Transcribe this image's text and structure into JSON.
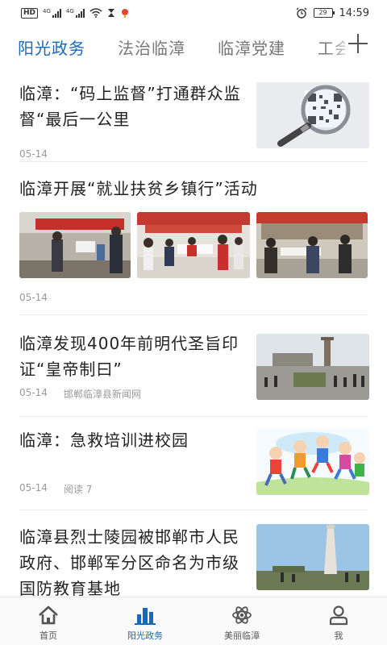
{
  "status_bar": {
    "hd": "HD",
    "net_1": "4G",
    "net_2": "4G",
    "battery": "29",
    "time": "14:59"
  },
  "tabs": [
    {
      "label": "阳光政务",
      "active": true
    },
    {
      "label": "法治临漳",
      "active": false
    },
    {
      "label": "临漳党建",
      "active": false
    },
    {
      "label": "工会",
      "active": false
    }
  ],
  "feed": [
    {
      "title": "临漳：“码上监督”打通群众监督“最后一公里",
      "date": "05-14",
      "source": "",
      "reads": "",
      "image": "magnifier-qr-photo"
    },
    {
      "title": "临漳开展“就业扶贫乡镇行”活动",
      "date": "05-14",
      "source": "",
      "reads": "",
      "images": [
        "event-photo-1",
        "event-photo-2",
        "event-photo-3"
      ]
    },
    {
      "title": "临漳发现400年前明代圣旨印证“皇帝制曰”",
      "date": "05-14",
      "source": "邯郸临漳县新闻网",
      "reads": "",
      "image": "plaza-photo"
    },
    {
      "title": "临漳：急救培训进校园",
      "date": "05-14",
      "source": "",
      "reads": "阅读 7",
      "image": "cartoon-kids-image"
    },
    {
      "title": "临漳县烈士陵园被邯郸市人民政府、邯郸军分区命名为市级国防教育基地",
      "date": "",
      "source": "",
      "reads": "",
      "image": "monument-photo"
    }
  ],
  "bottom_nav": [
    {
      "label": "首页",
      "icon": "home-icon",
      "active": false
    },
    {
      "label": "阳光政务",
      "icon": "buildings-icon",
      "active": true
    },
    {
      "label": "美丽临漳",
      "icon": "atom-icon",
      "active": false
    },
    {
      "label": "我",
      "icon": "person-icon",
      "active": false
    }
  ],
  "colors": {
    "accent": "#1a68b8",
    "text": "#222222",
    "meta": "#999999"
  }
}
